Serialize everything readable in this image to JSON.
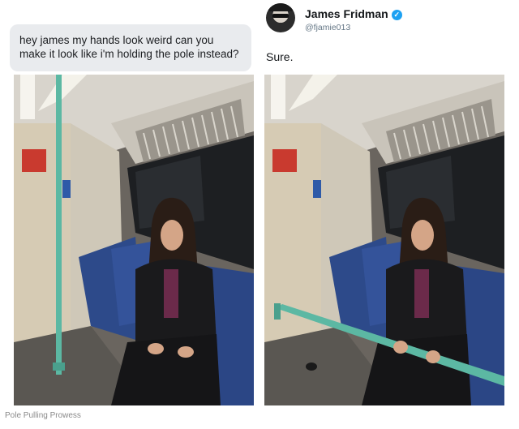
{
  "request": {
    "text": "hey james my hands look weird can you make it look like i'm holding the pole instead?"
  },
  "profile": {
    "name": "James Fridman",
    "handle": "@fjamie013",
    "verified_glyph": "✓",
    "avatar_icon": "avatar-icon",
    "verified_icon": "verified-badge-icon"
  },
  "reply": {
    "text": "Sure."
  },
  "photos": {
    "original": "subway car, woman seated, vertical green pole",
    "edited": "subway car, woman seated holding horizontal green pole"
  },
  "caption": "Pole Pulling Prowess",
  "colors": {
    "bubble_bg": "#e9ebee",
    "pole": "#5cb8a3",
    "verified": "#1da1f2",
    "seat": "#2d4a8a"
  }
}
